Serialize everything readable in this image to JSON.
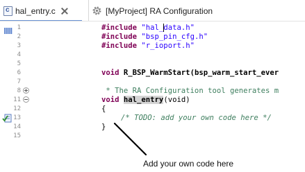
{
  "tabs": [
    {
      "label": "hal_entry.c",
      "icon": "c-source-file-icon",
      "active": true
    },
    {
      "label": "[MyProject] RA Configuration",
      "icon": "gear-icon",
      "active": false
    }
  ],
  "c_icon_glyph": "c",
  "line_numbers": [
    "1",
    "2",
    "3",
    "4",
    "5",
    "6",
    "7",
    "8",
    "11",
    "12",
    "13",
    "14",
    "15"
  ],
  "code": {
    "include_kw": "#include",
    "include1_a": "\"hal_",
    "include1_b": "data.h\"",
    "include2": "\"bsp_pin_cfg.h\"",
    "include3": "\"r_ioport.h\"",
    "void_kw": "void",
    "warmstart_decl": " R_BSP_WarmStart(bsp_warm_start_ever",
    "collapsed_comment": " * The RA Configuration tool generates m",
    "hal_entry_name": "hal_entry",
    "hal_entry_args": "(void)",
    "open_brace": "{",
    "todo_comment": "/* TODO: add your own code here */",
    "close_brace": "}"
  },
  "annotation": "Add your own code here",
  "colors": {
    "keyword": "#7f0055",
    "string": "#2a00ff",
    "comment": "#3f7f5f",
    "line_number": "#8c8c8c",
    "active_tab_underline": "#6a93d4"
  }
}
